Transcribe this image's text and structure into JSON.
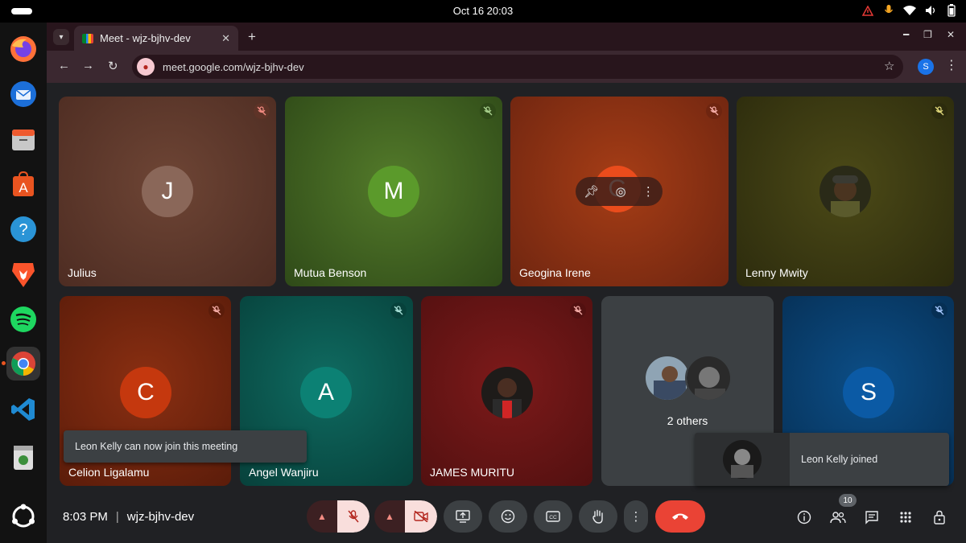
{
  "os": {
    "datetime": "Oct 16  20:03",
    "tray_icons": [
      "warning-icon",
      "mic-icon",
      "wifi-icon",
      "speaker-icon",
      "battery-icon"
    ]
  },
  "dock": {
    "apps": [
      "firefox",
      "thunderbird",
      "files",
      "app-center",
      "help",
      "brave",
      "spotify",
      "chrome",
      "vscode",
      "trash",
      "show-apps"
    ]
  },
  "browser": {
    "tab_title": "Meet - wjz-bjhv-dev",
    "url": "meet.google.com/wjz-bjhv-dev",
    "profile_initial": "S"
  },
  "meet": {
    "tiles": [
      {
        "name": "Julius",
        "initial": "J",
        "color": "#8a6759"
      },
      {
        "name": "Mutua Benson",
        "initial": "M",
        "color": "#5b9a2b"
      },
      {
        "name": "Geogina Irene",
        "initial": "G",
        "color": "#ea4c1c"
      },
      {
        "name": "Lenny Mwity",
        "initial": "",
        "color": "#3d3d12"
      },
      {
        "name": "Celion Ligalamu",
        "initial": "C",
        "color": "#c5380e"
      },
      {
        "name": "Angel Wanjiru",
        "initial": "A",
        "color": "#0c8174"
      },
      {
        "name": "JAMES MURITU",
        "initial": "",
        "color": "#7d1a1a"
      },
      {
        "name": "2 others",
        "initial": "",
        "color": "#3c4043"
      },
      {
        "name": "",
        "initial": "S",
        "color": "#0b5aa5"
      }
    ],
    "toast_left": "Leon Kelly can now join this meeting",
    "toast_right": "Leon Kelly joined"
  },
  "bottombar": {
    "time": "8:03 PM",
    "separator": "|",
    "meeting_code": "wjz-bjhv-dev",
    "participant_count": "10"
  }
}
